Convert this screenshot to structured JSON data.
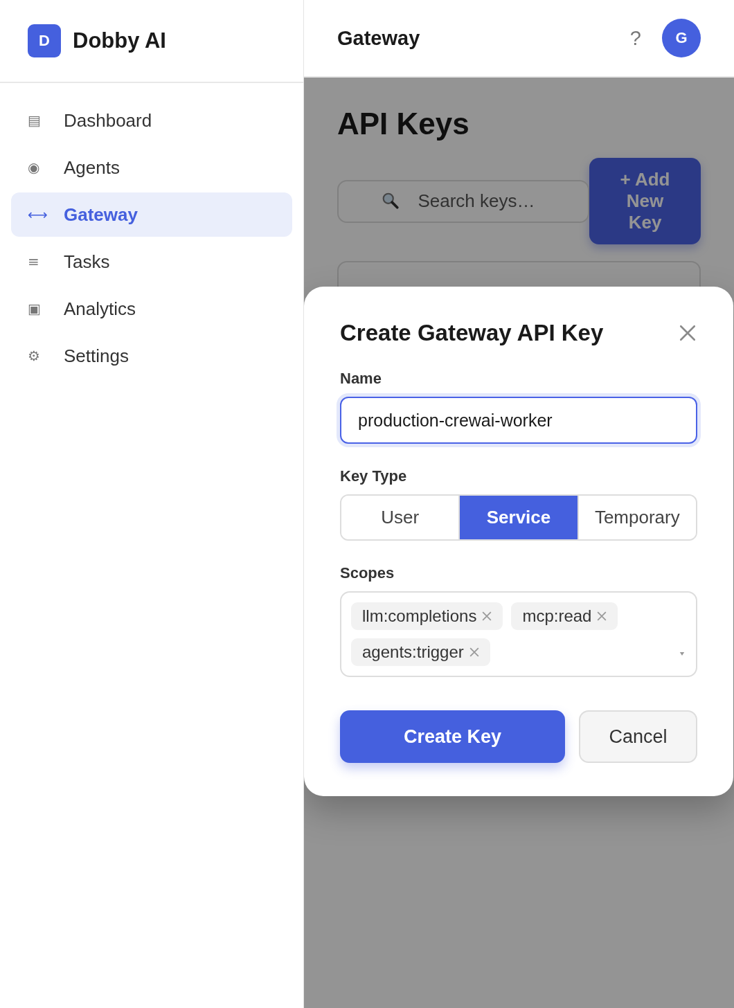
{
  "sidebar": {
    "logo": {
      "letter": "D",
      "name": "Dobby AI"
    },
    "items": [
      {
        "icon": "▤",
        "label": "Dashboard",
        "selected": false
      },
      {
        "icon": "◉",
        "label": "Agents",
        "selected": false
      },
      {
        "icon": "⟷",
        "label": "Gateway",
        "selected": true
      },
      {
        "icon": "≡",
        "label": "Tasks",
        "selected": false
      },
      {
        "icon": "▣",
        "label": "Analytics",
        "selected": false
      },
      {
        "icon": "⚙",
        "label": "Settings",
        "selected": false
      }
    ]
  },
  "header": {
    "title": "Gateway",
    "help": "?",
    "avatar": "G"
  },
  "page": {
    "title": "API Keys",
    "search": {
      "placeholder": "Search keys…"
    },
    "add_button": "+ Add New Key"
  },
  "dialog": {
    "title": "Create Gateway API Key",
    "name_field": {
      "label": "Name",
      "value": "production-crewai-worker"
    },
    "key_type": {
      "label": "Key Type",
      "options": [
        {
          "label": "User",
          "selected": false
        },
        {
          "label": "Service",
          "selected": true
        },
        {
          "label": "Temporary",
          "selected": false
        }
      ]
    },
    "scopes": {
      "label": "Scopes",
      "chips": [
        "llm:completions",
        "mcp:read",
        "agents:trigger"
      ]
    },
    "buttons": [
      {
        "label": "Create Key",
        "kind": "primary"
      },
      {
        "label": "Cancel",
        "kind": "secondary"
      }
    ]
  }
}
